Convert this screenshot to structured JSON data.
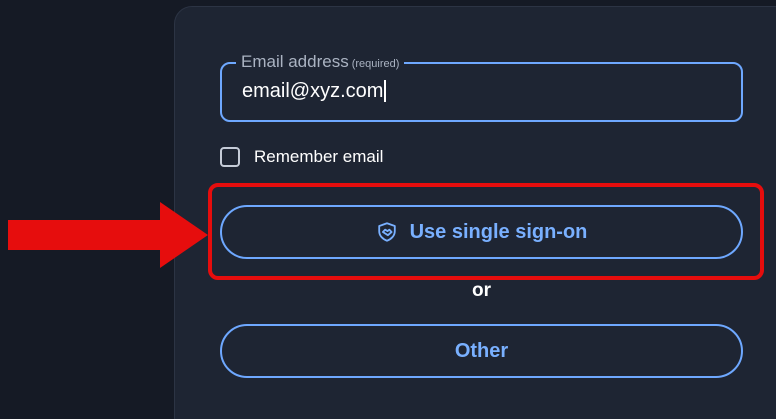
{
  "login_form": {
    "email_legend": "Email address",
    "email_required_note": "(required)",
    "email_value": "email@xyz.com",
    "remember_label": "Remember email",
    "remember_checked": false,
    "sso_button_label": "Use single sign-on",
    "sso_icon": "handshake-shield-icon",
    "or_text": "or",
    "other_button_label": "Other"
  },
  "annotations": {
    "highlight_color": "#e60d0d",
    "arrow_icon": "red-arrow-right-icon"
  },
  "colors": {
    "background": "#151a25",
    "card": "#1e2533",
    "accent": "#6ea8ff",
    "text": "#ffffff"
  }
}
